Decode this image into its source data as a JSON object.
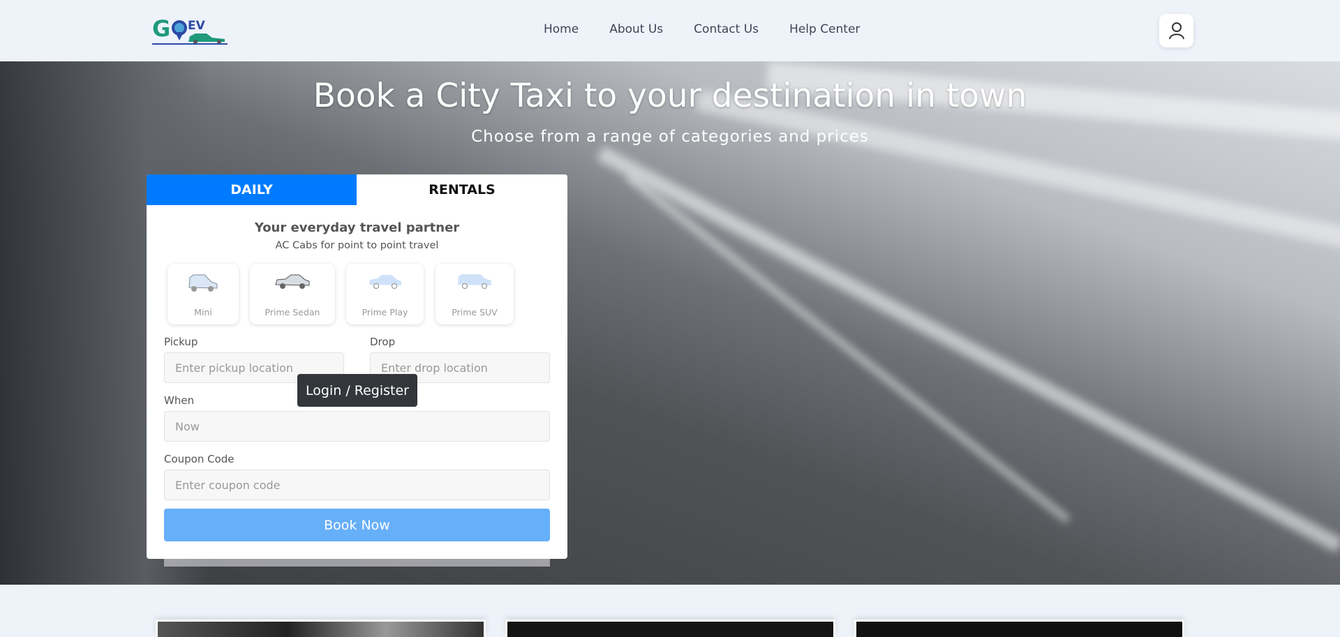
{
  "brand": {
    "logo_text": "GOEV",
    "colors": {
      "primary": "#007bff",
      "book_button": "#66aff9",
      "logo_green": "#1f9a7a",
      "logo_blue": "#2b4aa5"
    }
  },
  "nav": {
    "links": [
      "Home",
      "About Us",
      "Contact Us",
      "Help Center"
    ],
    "profile_icon": "user-icon"
  },
  "hero": {
    "title": "Book a City Taxi to your destination in town",
    "subtitle": "Choose from a range of categories and prices"
  },
  "booking": {
    "tabs": [
      {
        "label": "DAILY",
        "active": true
      },
      {
        "label": "RENTALS",
        "active": false
      }
    ],
    "heading": "Your everyday travel partner",
    "subheading": "AC Cabs for point to point travel",
    "vehicles": [
      {
        "label": "Mini",
        "icon": "hatchback-icon"
      },
      {
        "label": "Prime Sedan",
        "icon": "sedan-icon"
      },
      {
        "label": "Prime Play",
        "icon": "car-icon"
      },
      {
        "label": "Prime SUV",
        "icon": "suv-icon"
      }
    ],
    "pickup": {
      "label": "Pickup",
      "placeholder": "Enter pickup location"
    },
    "drop": {
      "label": "Drop",
      "placeholder": "Enter drop location"
    },
    "when": {
      "label": "When",
      "value": "Now"
    },
    "coupon": {
      "label": "Coupon Code",
      "placeholder": "Enter coupon code"
    },
    "book_button": "Book Now",
    "tooltip": "Login / Register"
  }
}
